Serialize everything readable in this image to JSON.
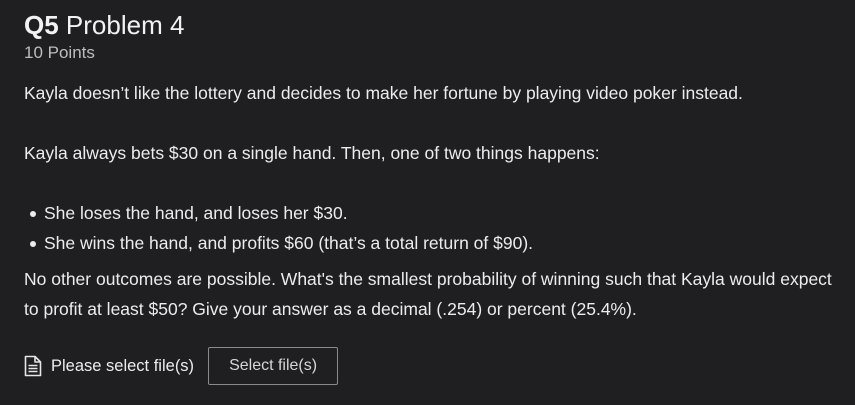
{
  "question": {
    "number": "Q5",
    "title": "Problem 4",
    "points": "10 Points",
    "paragraph1": "Kayla doesn’t like the lottery and decides to make her fortune by playing video poker instead.",
    "paragraph2": "Kayla always bets $30 on a single hand. Then, one of two things happens:",
    "outcomes": [
      "She loses the hand, and loses her $30.",
      "She wins the hand, and profits $60 (that’s a total return of $90)."
    ],
    "paragraph3": "No other outcomes are possible. What's the smallest probability of winning such that Kayla would expect to profit at least $50? Give your answer as a decimal (.254) or percent (25.4%)."
  },
  "upload": {
    "icon": "file-icon",
    "label": "Please select file(s)",
    "button_label": "Select file(s)"
  },
  "colors": {
    "background": "#1f1f21",
    "text": "#ececec",
    "muted": "#bdbdbd",
    "button_border": "#8a8a8a"
  }
}
